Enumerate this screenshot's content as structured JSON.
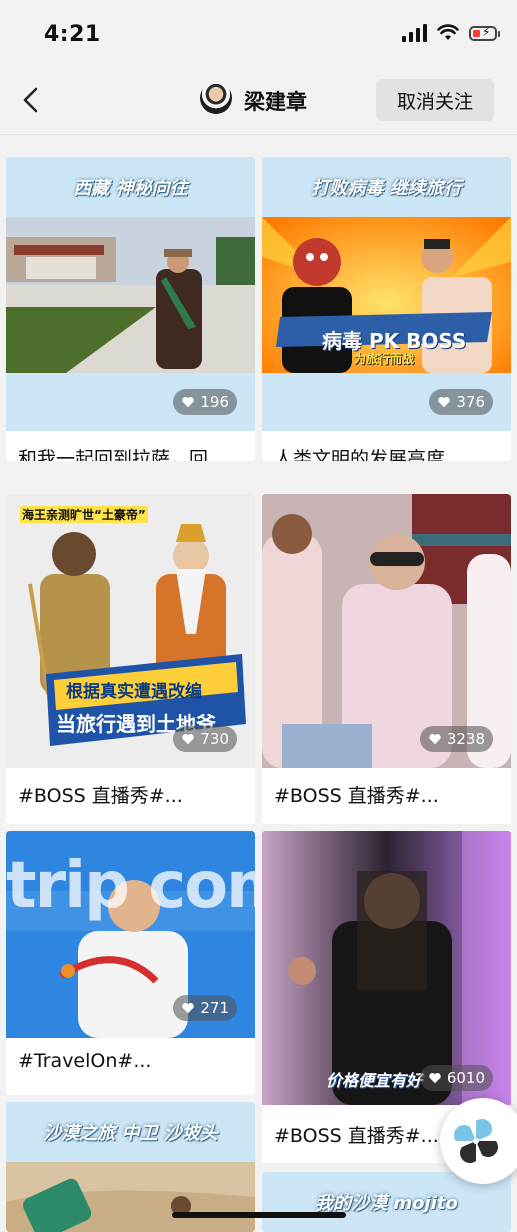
{
  "status": {
    "time": "4:21"
  },
  "header": {
    "title": "梁建章",
    "unfollow_label": "取消关注"
  },
  "cards": [
    {
      "banner": "西藏 神秘向往",
      "likes": "196",
      "caption": "和我一起回到拉萨，回..."
    },
    {
      "banner": "打败病毒 继续旅行",
      "likes": "376",
      "caption": "人类文明的发展高度...",
      "poster_text": "病毒 PK BOSS",
      "poster_sub": "为旅行而战"
    },
    {
      "likes": "730",
      "caption": "#BOSS 直播秀#...",
      "poster_top": "海王亲测旷世“土豪帝”",
      "poster_line1": "根据真实遭遇改编",
      "poster_line2": "当旅行遇到土地爷"
    },
    {
      "likes": "3238",
      "caption": "#BOSS 直播秀#..."
    },
    {
      "likes": "271",
      "caption": "#TravelOn#...",
      "poster_text": "trip com"
    },
    {
      "likes": "6010",
      "caption": "#BOSS 直播秀#...",
      "poster_text": "价格便宜有好"
    },
    {
      "banner": "沙漠之旅 中卫 沙坡头"
    },
    {
      "banner": "我的沙漠 mojito"
    }
  ],
  "colors": {
    "background": "#f2f2f2",
    "banner": "#cde6f7",
    "like_pill": "#5a5a5a",
    "battery_low": "#ff3b30"
  }
}
